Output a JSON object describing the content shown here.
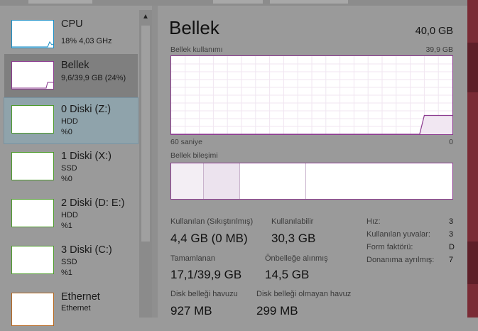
{
  "sidebar": {
    "items": [
      {
        "title": "CPU",
        "sub1": "18% 4,03 GHz",
        "sub2": "",
        "color": "#1a8dc4"
      },
      {
        "title": "Bellek",
        "sub1": "9,6/39,9 GB (24%)",
        "sub2": "",
        "color": "#8b3a8f"
      },
      {
        "title": "0 Diski (Z:)",
        "sub1": "HDD",
        "sub2": "%0",
        "color": "#4c9a2a"
      },
      {
        "title": "1 Diski (X:)",
        "sub1": "SSD",
        "sub2": "%0",
        "color": "#4c9a2a"
      },
      {
        "title": "2 Diski (D: E:)",
        "sub1": "HDD",
        "sub2": "%1",
        "color": "#4c9a2a"
      },
      {
        "title": "3 Diski (C:)",
        "sub1": "SSD",
        "sub2": "%1",
        "color": "#4c9a2a"
      },
      {
        "title": "Ethernet",
        "sub1": "Ethernet",
        "sub2": "",
        "color": "#b5651d"
      }
    ],
    "scroll_up_glyph": "▲"
  },
  "main": {
    "title": "Bellek",
    "total": "40,0 GB",
    "usage_label": "Bellek kullanımı",
    "usage_max": "39,9 GB",
    "time_label": "60 saniye",
    "time_end": "0",
    "composition_label": "Bellek bileşimi",
    "stats": [
      {
        "label": "Kullanılan (Sıkıştırılmış)",
        "value": "4,4 GB (0 MB)"
      },
      {
        "label": "Kullanılabilir",
        "value": "30,3 GB"
      },
      {
        "label": "Tamamlanan",
        "value": "17,1/39,9 GB"
      },
      {
        "label": "Önbelleğe alınmış",
        "value": "14,5 GB"
      },
      {
        "label": "Disk belleği havuzu",
        "value": "927 MB"
      },
      {
        "label": "Disk belleği olmayan havuz",
        "value": "299 MB"
      }
    ],
    "props": [
      {
        "label": "Hız:",
        "value": "3"
      },
      {
        "label": "Kullanılan yuvalar:",
        "value": "3"
      },
      {
        "label": "Form faktörü:",
        "value": "D"
      },
      {
        "label": "Donanıma ayrılmış:",
        "value": "7"
      }
    ]
  },
  "chart_data": {
    "type": "line",
    "title": "Bellek kullanımı",
    "ylim": [
      0,
      39.9
    ],
    "x_range_seconds": [
      60,
      0
    ],
    "series": [
      {
        "values_gb": [
          0,
          0,
          0,
          0,
          0,
          0,
          0,
          0,
          0,
          0,
          0,
          0,
          0,
          0,
          0,
          0,
          0,
          0,
          0,
          0,
          0,
          0,
          0,
          0,
          0,
          0,
          0,
          0,
          0,
          0,
          0,
          0,
          0,
          0,
          0,
          0,
          0,
          0,
          0,
          0,
          0,
          0,
          0,
          0,
          0,
          0,
          0,
          0,
          0,
          0,
          0,
          0,
          0,
          0,
          9.6,
          9.6,
          9.6,
          9.6,
          9.6,
          9.6,
          9.6
        ]
      }
    ]
  }
}
